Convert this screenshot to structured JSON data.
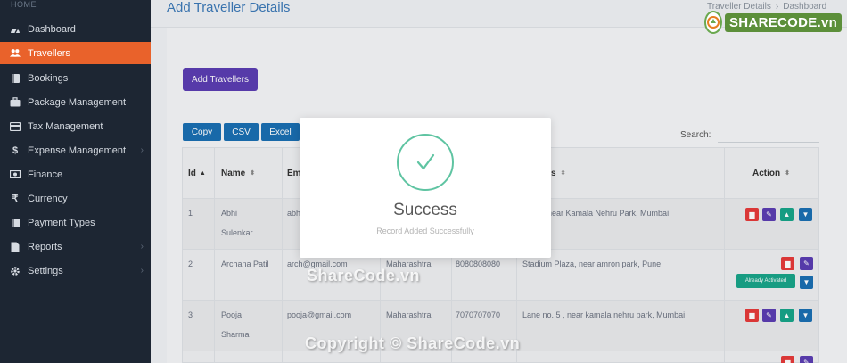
{
  "sidebar": {
    "section_label": "HOME",
    "items": [
      {
        "label": "Dashboard",
        "icon": "dashboard-icon"
      },
      {
        "label": "Travellers",
        "icon": "users-icon"
      },
      {
        "label": "Bookings",
        "icon": "book-icon"
      },
      {
        "label": "Package Management",
        "icon": "briefcase-icon"
      },
      {
        "label": "Tax Management",
        "icon": "credit-card-icon"
      },
      {
        "label": "Expense Management",
        "icon": "dollar-icon"
      },
      {
        "label": "Finance",
        "icon": "money-icon"
      },
      {
        "label": "Currency",
        "icon": "rupee-icon"
      },
      {
        "label": "Payment Types",
        "icon": "book-icon"
      },
      {
        "label": "Reports",
        "icon": "report-icon"
      },
      {
        "label": "Settings",
        "icon": "gear-icon"
      }
    ],
    "active_color": "#e9622b"
  },
  "header": {
    "title": "Add Traveller Details",
    "breadcrumb": [
      "Traveller Details",
      "Dashboard"
    ]
  },
  "toolbar": {
    "add_label": "Add Travellers",
    "export_buttons": [
      "Copy",
      "CSV",
      "Excel"
    ],
    "search_label": "Search:"
  },
  "table": {
    "columns": [
      "Id",
      "Name",
      "Em",
      "s",
      "Action"
    ],
    "rows": [
      {
        "id": "1",
        "name_line1": "Abhi",
        "name_line2": "Sulenkar",
        "email": "abh",
        "state": "",
        "phone": "",
        "address": "5, near Kamala Nehru Park, Mumbai"
      },
      {
        "id": "2",
        "name_line1": "Archana Patil",
        "name_line2": "",
        "email": "arch@gmail.com",
        "state": "Maharashtra",
        "phone": "8080808080",
        "address": "Stadium Plaza, near amron park, Pune",
        "badge": "Already Activated"
      },
      {
        "id": "3",
        "name_line1": "Pooja",
        "name_line2": "Sharma",
        "email": "pooja@gmail.com",
        "state": "Maharashtra",
        "phone": "7070707070",
        "address": "Lane no. 5 , near kamala nehru park, Mumbai"
      }
    ]
  },
  "modal": {
    "title": "Success",
    "message": "Record Added Successfully"
  },
  "logo": {
    "text": "SHARECODE.vn"
  },
  "watermarks": [
    "ShareCode.vn",
    "Copyright © ShareCode.vn"
  ]
}
